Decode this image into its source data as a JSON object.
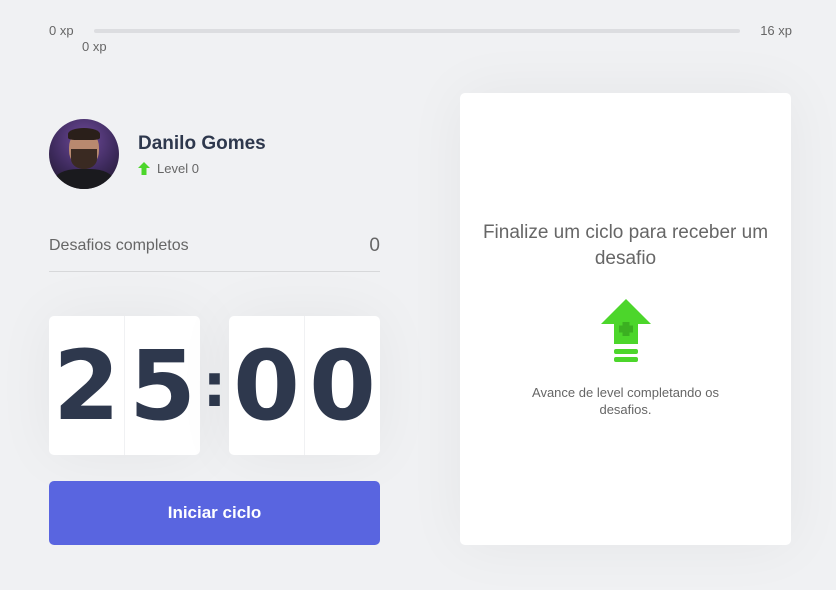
{
  "experience": {
    "min_label": "0 xp",
    "max_label": "16 xp",
    "current_label": "0 xp",
    "progress": 0
  },
  "profile": {
    "name": "Danilo Gomes",
    "level_label": "Level 0"
  },
  "challenges": {
    "label": "Desafios completos",
    "count": "0"
  },
  "countdown": {
    "minute_left": "2",
    "minute_right": "5",
    "separator": ":",
    "second_left": "0",
    "second_right": "0"
  },
  "start_button": {
    "label": "Iniciar ciclo"
  },
  "challenge_box": {
    "title": "Finalize um ciclo para receber um desafio",
    "text": "Avance de level completando os desafios."
  },
  "colors": {
    "background": "#f0f1f3",
    "primary": "#5965e0",
    "green": "#4cd62b",
    "title": "#2e384d",
    "text": "#666666"
  },
  "icons": {
    "level": "arrow-up-icon",
    "level_up": "level-up-icon"
  }
}
